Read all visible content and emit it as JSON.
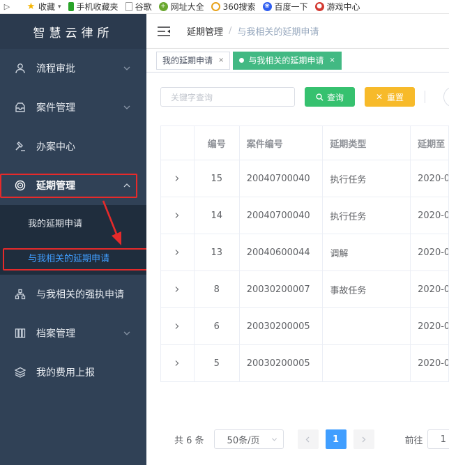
{
  "bookmarks": {
    "items": [
      {
        "label": "收藏",
        "icon": "star-icon",
        "color": "#f5b400"
      },
      {
        "label": "手机收藏夹",
        "icon": "phone-icon",
        "color": "#29a329"
      },
      {
        "label": "谷歌",
        "icon": "page-icon",
        "color": "#999999"
      },
      {
        "label": "网址大全",
        "icon": "plus-icon",
        "color": "#6aa82f"
      },
      {
        "label": "360搜索",
        "icon": "search-icon",
        "color": "#e7a21b"
      },
      {
        "label": "百度一下",
        "icon": "paw-icon",
        "color": "#2f5ef0"
      },
      {
        "label": "游戏中心",
        "icon": "gamepad-icon",
        "color": "#d33a32"
      }
    ]
  },
  "sidebar": {
    "title": "智慧云律所",
    "items": [
      {
        "label": "流程审批",
        "icon": "user-icon"
      },
      {
        "label": "案件管理",
        "icon": "inbox-icon"
      },
      {
        "label": "办案中心",
        "icon": "gavel-icon"
      },
      {
        "label": "延期管理",
        "icon": "target-icon"
      },
      {
        "label": "与我相关的强执申请",
        "icon": "sitemap-icon"
      },
      {
        "label": "档案管理",
        "icon": "archive-icon"
      },
      {
        "label": "我的费用上报",
        "icon": "layers-icon"
      }
    ],
    "submenu": [
      {
        "label": "我的延期申请"
      },
      {
        "label": "与我相关的延期申请"
      }
    ]
  },
  "navbar": {
    "crumb1": "延期管理",
    "separator": "/",
    "crumb2": "与我相关的延期申请"
  },
  "tags": [
    {
      "label": "我的延期申请",
      "close": "×"
    },
    {
      "label": "与我相关的延期申请",
      "close": "×"
    }
  ],
  "search": {
    "placeholder": "关键字查询",
    "query_label": "查询",
    "reset_label": "重置"
  },
  "table": {
    "headers": [
      "编号",
      "案件编号",
      "延期类型",
      "延期至"
    ],
    "rows": [
      {
        "id": "15",
        "case": "20040700040",
        "type": "执行任务",
        "until": "2020-0"
      },
      {
        "id": "14",
        "case": "20040700040",
        "type": "执行任务",
        "until": "2020-0"
      },
      {
        "id": "13",
        "case": "20040600044",
        "type": "调解",
        "until": "2020-0"
      },
      {
        "id": "8",
        "case": "20030200007",
        "type": "事故任务",
        "until": "2020-0"
      },
      {
        "id": "6",
        "case": "20030200005",
        "type": "",
        "until": "2020-0"
      },
      {
        "id": "5",
        "case": "20030200005",
        "type": "",
        "until": "2020-0"
      }
    ]
  },
  "pagination": {
    "total": "共 6 条",
    "page_size": "50条/页",
    "current_page": "1",
    "goto_label": "前往",
    "goto_value": "1"
  },
  "colors": {
    "sidebar_bg": "#304156",
    "accent": "#409eff",
    "tag_active": "#42b983",
    "query_btn": "#36c16f",
    "reset_btn": "#f7ba2a",
    "highlight": "#e62a2a"
  }
}
